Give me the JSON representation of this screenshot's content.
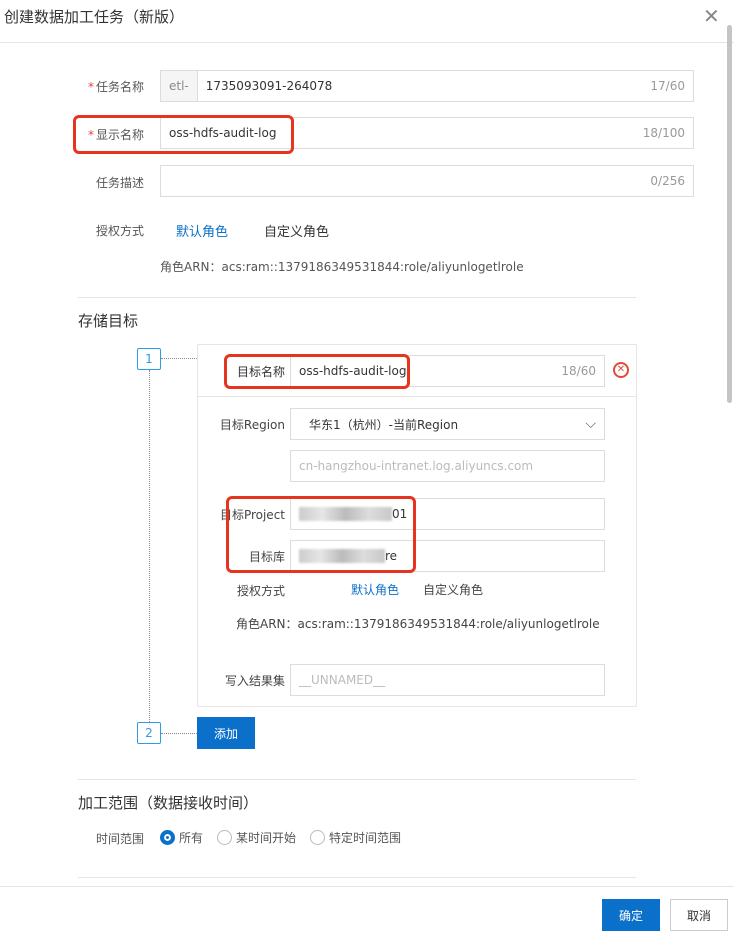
{
  "dialog": {
    "title": "创建数据加工任务（新版）"
  },
  "form": {
    "task_name": {
      "label": "任务名称",
      "prefix": "etl-",
      "value": "1735093091-264078",
      "count": "17/60"
    },
    "display_name": {
      "label": "显示名称",
      "value": "oss-hdfs-audit-log",
      "count": "18/100"
    },
    "task_desc": {
      "label": "任务描述",
      "value": "",
      "count": "0/256"
    },
    "auth": {
      "label": "授权方式",
      "default_role": "默认角色",
      "custom_role": "自定义角色",
      "arn": "角色ARN：acs:ram::1379186349531844:role/aliyunlogetlrole"
    }
  },
  "storage": {
    "title": "存储目标",
    "steps": [
      "1",
      "2"
    ],
    "target": {
      "name_label": "目标名称",
      "name_value": "oss-hdfs-audit-log",
      "name_count": "18/60",
      "region_label": "目标Region",
      "region_value": "华东1（杭州）-当前Region",
      "endpoint": "cn-hangzhou-intranet.log.aliyuncs.com",
      "project_label": "目标Project",
      "project_value_suffix": "01",
      "logstore_label": "目标库",
      "logstore_value_suffix": "re",
      "auth_label": "授权方式",
      "default_role": "默认角色",
      "custom_role": "自定义角色",
      "arn_label": "角色ARN：",
      "arn_value": "acs:ram::1379186349531844:role/aliyunlogetlrole",
      "result_label": "写入结果集",
      "result_placeholder": "__UNNAMED__"
    },
    "add_label": "添加"
  },
  "range": {
    "title": "加工范围（数据接收时间）",
    "label": "时间范围",
    "options": [
      "所有",
      "某时间开始",
      "特定时间范围"
    ],
    "selected": "所有"
  },
  "footer": {
    "ok": "确定",
    "cancel": "取消"
  },
  "colors": {
    "accent": "#0a70c9",
    "highlight": "#e5341f"
  }
}
